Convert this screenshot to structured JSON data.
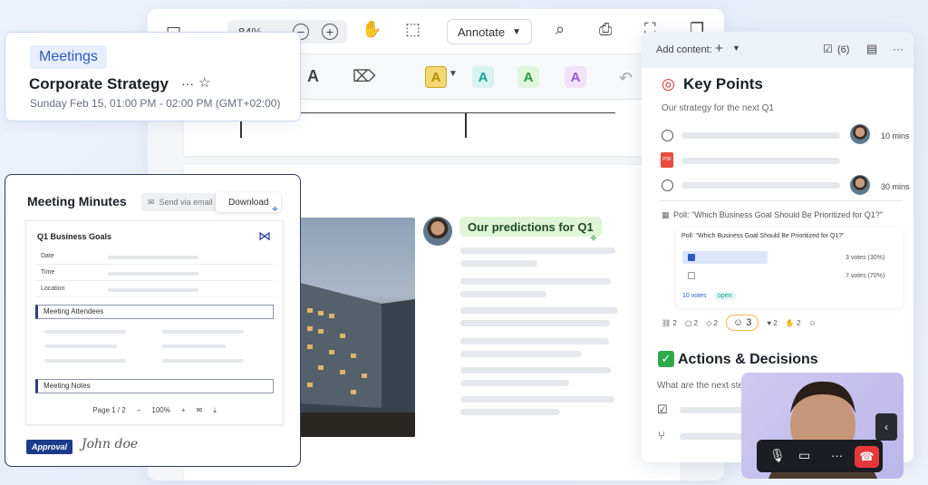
{
  "editor": {
    "zoom": "84%",
    "annotate_label": "Annotate",
    "prediction_label": "Our predictions for Q1"
  },
  "meetings": {
    "tag": "Meetings",
    "title": "Corporate Strategy",
    "time": "Sunday Feb 15, 01:00 PM - 02:00 PM (GMT+02:00)"
  },
  "minutes": {
    "title": "Meeting Minutes",
    "send_label": "Send via email",
    "download_label": "Download",
    "doc_title": "Q1 Business Goals",
    "rows": [
      "Date",
      "Time",
      "Location"
    ],
    "attendees_label": "Meeting Attendees",
    "notes_label": "Meeting Notes",
    "page_label": "Page 1 / 2",
    "zoom": "100%",
    "approval_label": "Approval",
    "signature": "John doe"
  },
  "panel": {
    "add_content_label": "Add content:",
    "count_badge": "(6)",
    "key_points_title": "Key Points",
    "key_points_sub": "Our strategy for the next Q1",
    "item1_time": "10 mins",
    "item3_time": "30 mins",
    "poll_header": "Poll: \"Which Business Goal Should Be Prioritized for Q1?\"",
    "poll_question": "Poll: \"Which Business Goal Should Be Prioritized for Q1?\"",
    "poll_opt1_votes": "3 votes (30%)",
    "poll_opt2_votes": "7 votes (70%)",
    "poll_total": "10 votes",
    "poll_status": "open",
    "reactions": [
      "2",
      "2",
      "2",
      "3",
      "2",
      "2"
    ],
    "actions_title": "Actions & Decisions",
    "actions_sub": "What are the next ste"
  }
}
